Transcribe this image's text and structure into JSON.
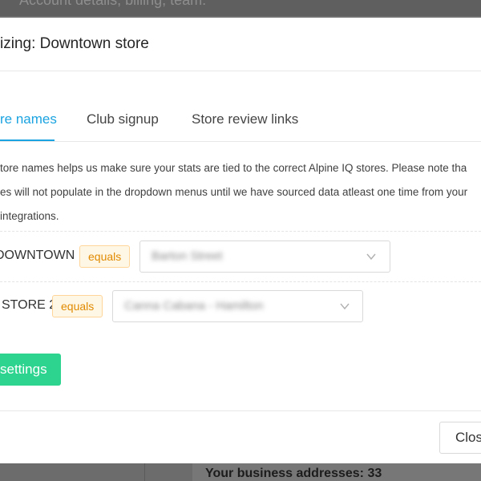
{
  "background": {
    "header_text": "Account details, billing, team.",
    "footer_text": "Your business addresses: 33"
  },
  "modal": {
    "title": "izing: Downtown store",
    "tabs": [
      {
        "label": "re names",
        "active": true
      },
      {
        "label": "Club signup",
        "active": false
      },
      {
        "label": "Store review links",
        "active": false
      }
    ],
    "description_lines": [
      "tore names helps us make sure your stats are tied to the correct Alpine IQ stores. Please note tha",
      "es will not populate in the dropdown menus until we have sourced data atleast one time from your",
      "integrations."
    ],
    "mappings": [
      {
        "store": "DOWNTOWN",
        "operator": "equals",
        "selected": "Barton Street"
      },
      {
        "store": "STORE 2",
        "operator": "equals",
        "selected": "Canna Cabana - Hamilton"
      }
    ],
    "save_label": "settings",
    "close_label": "Clos"
  },
  "colors": {
    "accent": "#1aa3e0",
    "primary_button": "#2cd48f",
    "tag_text": "#e08a00",
    "tag_bg": "#fff7e6"
  },
  "icons": {
    "select_arrow": "chevron-down-icon"
  }
}
